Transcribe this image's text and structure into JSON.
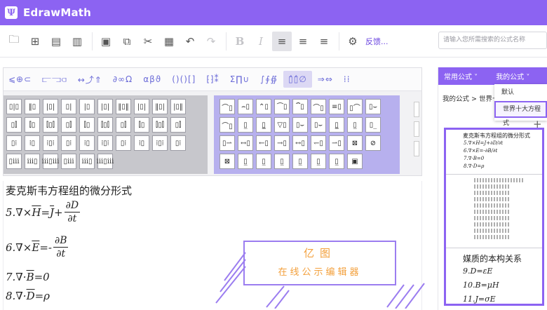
{
  "app": {
    "title": "EdrawMath",
    "logo": "Ψ"
  },
  "toolbar": {
    "buttons": [
      {
        "name": "open-file-icon",
        "glyph": "🗀"
      },
      {
        "name": "new-file-icon",
        "glyph": "⊞"
      },
      {
        "name": "save-icon",
        "glyph": "▤"
      },
      {
        "name": "export-icon",
        "glyph": "▥"
      },
      {
        "name": "print-icon",
        "glyph": "▣"
      },
      {
        "name": "copy-icon",
        "glyph": "⧉"
      },
      {
        "name": "cut-icon",
        "glyph": "✂"
      },
      {
        "name": "paste-icon",
        "glyph": "▦"
      },
      {
        "name": "undo-icon",
        "glyph": "↶"
      },
      {
        "name": "redo-icon",
        "glyph": "↷"
      },
      {
        "name": "bold-icon",
        "glyph": "B"
      },
      {
        "name": "italic-icon",
        "glyph": "I"
      },
      {
        "name": "align-left-icon",
        "glyph": "≡"
      },
      {
        "name": "align-center-icon",
        "glyph": "≡"
      },
      {
        "name": "align-right-icon",
        "glyph": "≡"
      },
      {
        "name": "feedback-icon",
        "glyph": "⚙"
      }
    ],
    "feedback_label": "反馈..."
  },
  "search": {
    "placeholder": "请输入您所需搜索的公式名称"
  },
  "palette": {
    "categories": [
      "⩽⊕⊂",
      "⫍⫎⫏",
      "↔⤴⇑",
      "∂∞Ω",
      "αβϑ",
      "()()[]",
      "⁅⁆⁑",
      "Σ∏∪",
      "∫∮∯",
      "▯̂▯̂∅",
      "⇒⇔",
      "⁞⁞"
    ],
    "active_category": 9,
    "left_cells": [
      "▯|▯",
      "‖▯",
      "|▯|",
      "▯|",
      "|▯",
      "|▯|",
      "‖▯‖",
      "|▯|",
      "‖▯|",
      "|▯‖",
      "▯⫿",
      "⫿▯",
      "⫿▯⫿",
      "▯⫿",
      "⫿▯",
      "⫿▯⫿",
      "▯⫿",
      "⫿▯",
      "⫿▯⫿",
      "▯⫿",
      "▯⁞",
      "⁞▯",
      "⁞▯⁞",
      "▯⁞",
      "⁞▯",
      "⁞▯⁞",
      "▯⁞",
      "⁞▯",
      "⁞▯⁞",
      "▯⁞",
      "▯ⅲ",
      "ⅲ▯",
      "ⅲ▯ⅲ",
      "▯ⅲ",
      "ⅲ▯",
      "ⅲ▯ⅲ"
    ],
    "right_cells": [
      "⌒▯",
      "⌢▯",
      "⌃▯",
      "⏜▯",
      "⏞▯",
      "⌒▯",
      "≡▯",
      "▯⌒",
      "▯⌣",
      "⌒▯",
      "▯̲",
      "▯̳",
      "▽▯",
      "▯⌣",
      "▯⌣",
      "▯̳",
      "▯̲",
      "▯_",
      "▯⇀",
      "↔▯",
      "←▯",
      "→▯",
      "↔▯",
      "↽▯",
      "⇀▯",
      "⊠",
      "⊘",
      "⊠",
      "▯̲",
      "▯̲",
      "▯̲",
      "▯̲",
      "▯̲",
      "▯̲",
      "▣"
    ]
  },
  "editor": {
    "title": "麦克斯韦方程组的微分形式",
    "eq5": {
      "lhs": "5.∇×",
      "H": "H",
      "mid": "=",
      "J": "J",
      "plus": "+",
      "num": "∂D",
      "den": "∂t"
    },
    "eq6": {
      "lhs": "6.∇×",
      "E": "E",
      "mid": "=-",
      "num": "∂B",
      "den": "∂t"
    },
    "eq7": {
      "lhs": "7.∇·",
      "B": "B",
      "rhs": "=0"
    },
    "eq8": {
      "lhs": "8.∇·",
      "D": "D",
      "rhs": "=ρ"
    }
  },
  "promo": {
    "line1": "亿图",
    "line2": "在线公示编辑器"
  },
  "right_panel": {
    "tab1": "常用公式 ˅",
    "tab2": "我的公式 ˅",
    "breadcrumb": "我的公式 > 世界十",
    "dropdown": [
      "默认",
      "世界十大方程式"
    ],
    "thumb1": {
      "title": "麦克斯韦方程组的微分形式",
      "lines": [
        "5.∇×H=J+∂D/∂t",
        "6.∇×E=-∂B/∂t",
        "7.∇·B=0",
        "8.∇·D=ρ"
      ]
    },
    "thumb3": {
      "title": "媒质的本构关系",
      "lines": [
        "9.D=εE",
        "10.B=μH",
        "11.J=σE"
      ]
    }
  },
  "colors": {
    "accent": "#8c63f2",
    "promo_text": "#f3a03c"
  }
}
